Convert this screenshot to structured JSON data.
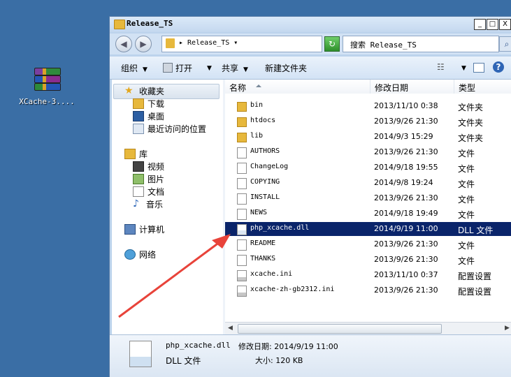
{
  "desktop": {
    "icon_label": "XCache-3...."
  },
  "window": {
    "title": "Release_TS",
    "buttons": {
      "minimize": "_",
      "maximize": "□",
      "close": "X"
    }
  },
  "address": {
    "path": "▸ Release_TS ▾",
    "search_placeholder": "搜索 Release_TS",
    "back": "◀",
    "forward": "▶",
    "refresh": "↻"
  },
  "toolbar": {
    "organize": "组织",
    "open": "打开",
    "share": "共享",
    "new_folder": "新建文件夹"
  },
  "sidebar": {
    "favorites": "收藏夹",
    "downloads": "下载",
    "desktop": "桌面",
    "recent": "最近访问的位置",
    "library": "库",
    "videos": "视频",
    "pictures": "图片",
    "documents": "文档",
    "music": "音乐",
    "computer": "计算机",
    "network": "网络"
  },
  "columns": {
    "name": "名称",
    "date": "修改日期",
    "type": "类型"
  },
  "files": [
    {
      "name": "bin",
      "date": "2013/11/10 0:38",
      "type": "文件夹",
      "kind": "folder"
    },
    {
      "name": "htdocs",
      "date": "2013/9/26 21:30",
      "type": "文件夹",
      "kind": "folder"
    },
    {
      "name": "lib",
      "date": "2014/9/3 15:29",
      "type": "文件夹",
      "kind": "folder"
    },
    {
      "name": "AUTHORS",
      "date": "2013/9/26 21:30",
      "type": "文件",
      "kind": "file"
    },
    {
      "name": "ChangeLog",
      "date": "2014/9/18 19:55",
      "type": "文件",
      "kind": "file"
    },
    {
      "name": "COPYING",
      "date": "2014/9/8 19:24",
      "type": "文件",
      "kind": "file"
    },
    {
      "name": "INSTALL",
      "date": "2013/9/26 21:30",
      "type": "文件",
      "kind": "file"
    },
    {
      "name": "NEWS",
      "date": "2014/9/18 19:49",
      "type": "文件",
      "kind": "file"
    },
    {
      "name": "php_xcache.dll",
      "date": "2014/9/19 11:00",
      "type": "DLL 文件",
      "kind": "dll",
      "selected": true
    },
    {
      "name": "README",
      "date": "2013/9/26 21:30",
      "type": "文件",
      "kind": "file"
    },
    {
      "name": "THANKS",
      "date": "2013/9/26 21:30",
      "type": "文件",
      "kind": "file"
    },
    {
      "name": "xcache.ini",
      "date": "2013/11/10 0:37",
      "type": "配置设置",
      "kind": "ini"
    },
    {
      "name": "xcache-zh-gb2312.ini",
      "date": "2013/9/26 21:30",
      "type": "配置设置",
      "kind": "ini"
    }
  ],
  "details": {
    "name": "php_xcache.dll",
    "modified": "修改日期: 2014/9/19 11:00",
    "type": "DLL 文件",
    "size": "大小: 120 KB"
  },
  "colors": {
    "selection": "#0a246a",
    "desktop": "#3a6ea5",
    "annotation_arrow": "#e8433a"
  }
}
